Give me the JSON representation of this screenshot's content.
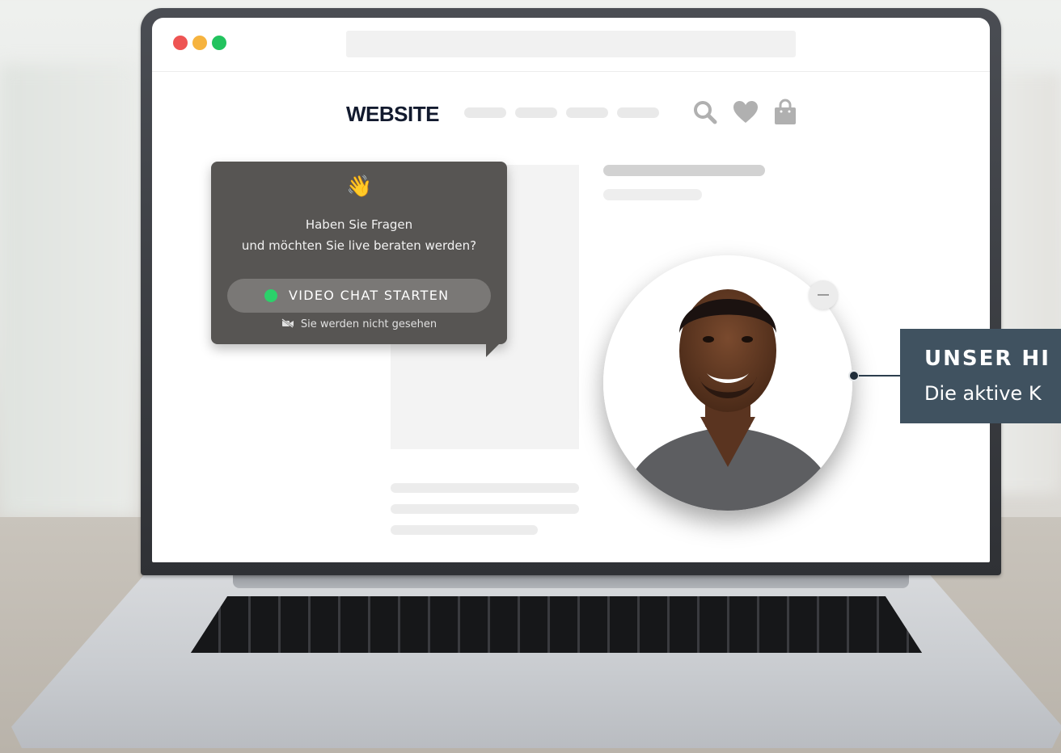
{
  "site": {
    "logo": "WEBSITE"
  },
  "chat_widget": {
    "wave_emoji": "👋",
    "question_line1": "Haben Sie Fragen",
    "question_line2": "und möchten Sie live beraten werden?",
    "start_button_label": "VIDEO CHAT STARTEN",
    "camera_note": "Sie werden nicht gesehen",
    "status_color": "#2bd16a"
  },
  "callout": {
    "title": "UNSER HI",
    "subtitle": "Die aktive K"
  },
  "icons": {
    "header": [
      "search-icon",
      "heart-icon",
      "bag-icon"
    ],
    "note": "camera-off-icon"
  },
  "colors": {
    "popup_bg": "#575553",
    "callout_bg": "#405260",
    "traffic_red": "#ee5453",
    "traffic_yellow": "#f6b33e",
    "traffic_green": "#22c35e"
  }
}
